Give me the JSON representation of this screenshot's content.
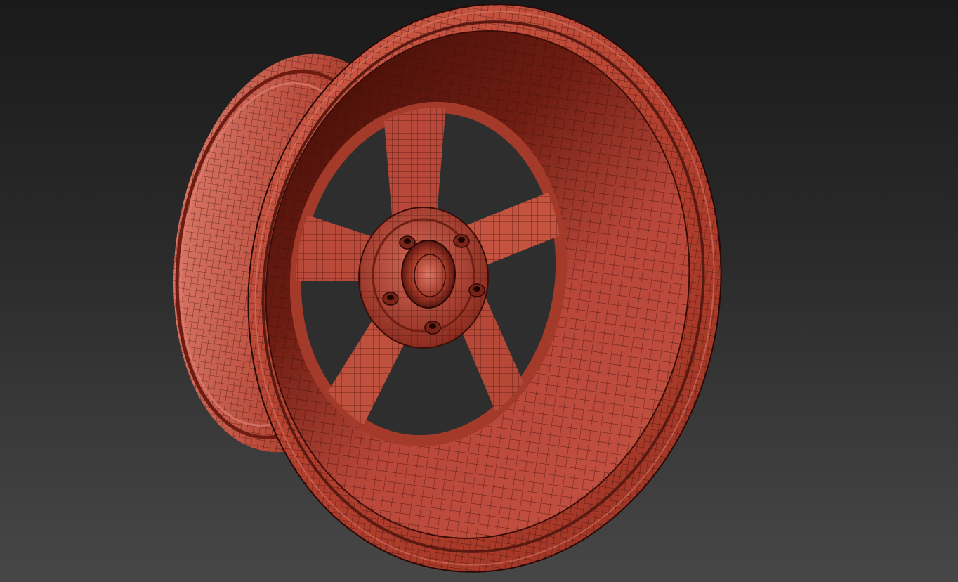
{
  "viewport": {
    "background_top": "#1a1a1a",
    "background_bottom": "#474747"
  },
  "model": {
    "object": "wheel-rim",
    "spoke_count": 5,
    "lug_count": 5,
    "display_mode": "shaded-with-wireframe",
    "shade_color": "#c2503e",
    "shade_dark": "#5a1a12",
    "shade_light": "#d86a58",
    "wire_color": "#3a0d08"
  }
}
